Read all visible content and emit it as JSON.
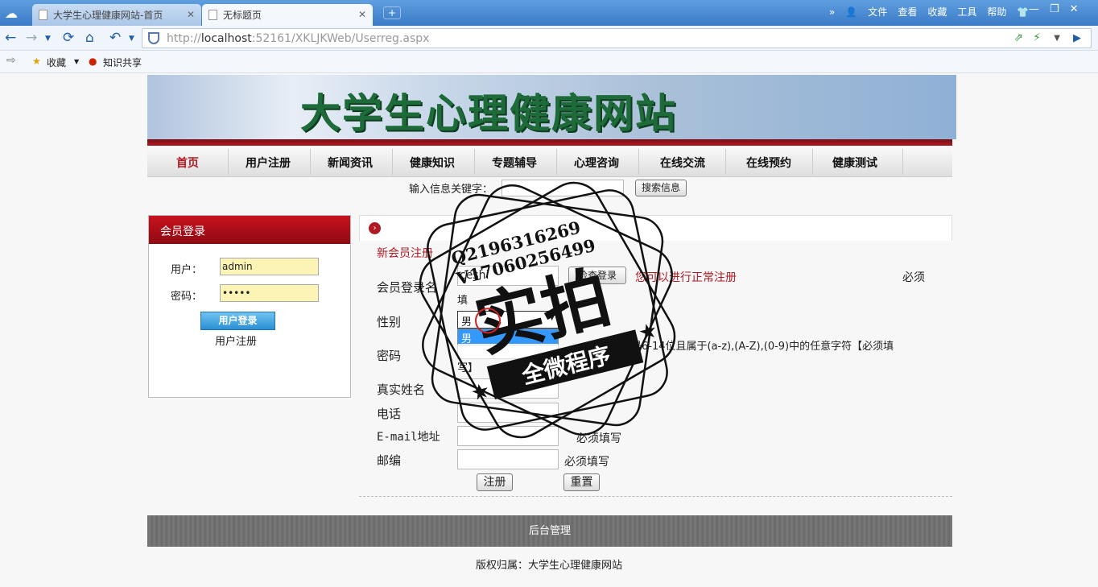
{
  "browser": {
    "tabs": [
      {
        "label": "大学生心理健康网站-首页"
      },
      {
        "label": "无标题页"
      }
    ],
    "menus": [
      "文件",
      "查看",
      "收藏",
      "工具",
      "帮助"
    ],
    "url_host": "localhost",
    "url_rest": ":52161/XKLJKWeb/Userreg.aspx",
    "url_prefix": "http://",
    "favorites_label": "收藏",
    "fav_item": "知识共享"
  },
  "site": {
    "banner_title": "大学生心理健康网站",
    "nav": [
      "首页",
      "用户注册",
      "新闻资讯",
      "健康知识",
      "专题辅导",
      "心理咨询",
      "在线交流",
      "在线预约",
      "健康测试"
    ],
    "search_label": "输入信息关键字：",
    "search_button": "搜索信息"
  },
  "login": {
    "header": "会员登录",
    "user_label": "用户：",
    "user_value": "admin",
    "pass_label": "密码：",
    "pass_value": "•••••",
    "login_button": "用户登录",
    "register_link": "用户注册"
  },
  "register": {
    "title": "新会员注册",
    "fields": {
      "username_label": "会员登录名",
      "username_value": "ceshi",
      "check_button": "检查登录",
      "username_ok": "您可以进行正常注册",
      "username_req": "必须",
      "username_req2": "填",
      "sex_label": "性别",
      "sex_value": "男",
      "sex_options": [
        "男",
        "女"
      ],
      "password_label": "密码",
      "password_note": "密码须是6-14位且属于(a-z),(A-Z),(0-9)中的任意字符【必须填",
      "password_note2": "写】",
      "realname_label": "真实姓名",
      "phone_label": "电话",
      "email_label": "E-mail地址",
      "email_req": "必须填写",
      "zip_label": "邮编",
      "zip_req": "必须填写"
    },
    "submit_button": "注册",
    "reset_button": "重置"
  },
  "footer": {
    "admin_link": "后台管理",
    "copyright": "版权归属：大学生心理健康网站"
  },
  "watermark": {
    "line1": "Q2196316269",
    "line2": "V17060256499",
    "big": "实拍",
    "ribbon": "全微程序"
  }
}
